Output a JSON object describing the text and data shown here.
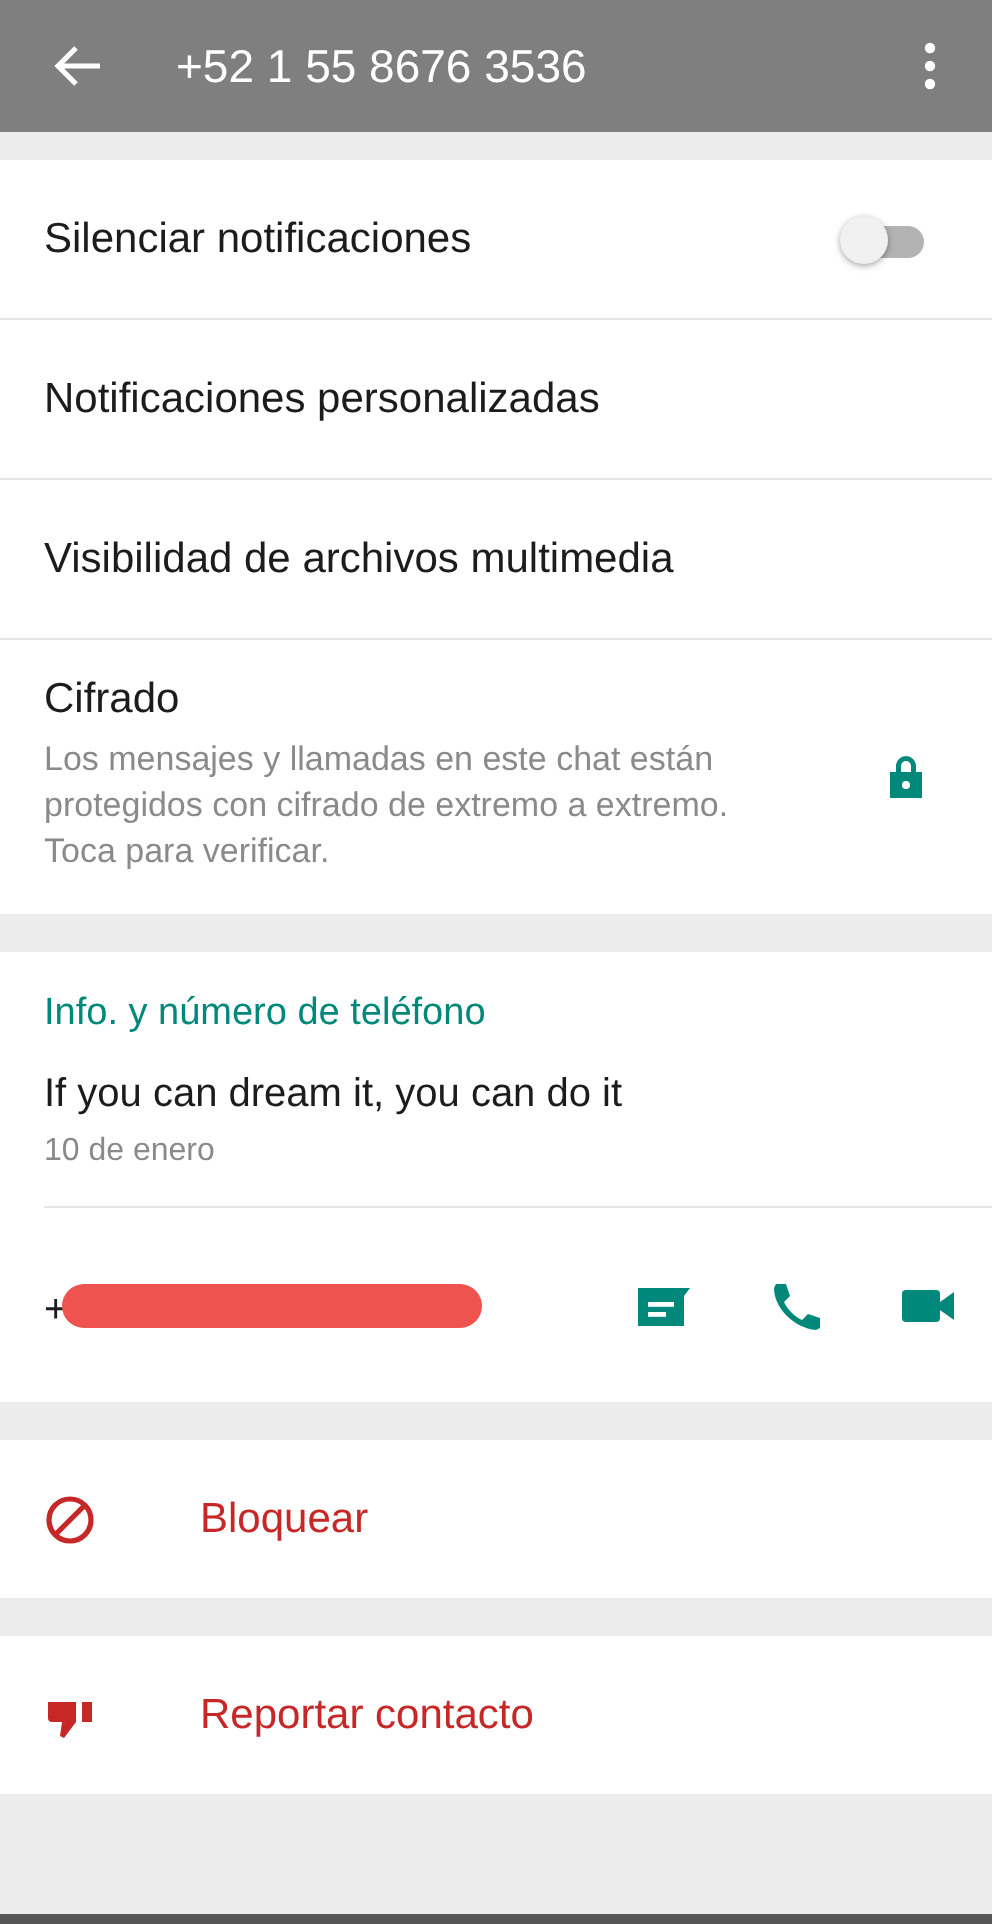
{
  "header": {
    "title": "+52 1 55 8676 3536"
  },
  "settings": [
    {
      "kind": "toggle",
      "label": "Silenciar notificaciones",
      "on": false
    },
    {
      "kind": "plain",
      "label": "Notificaciones personalizadas"
    },
    {
      "kind": "plain",
      "label": "Visibilidad de archivos multimedia"
    },
    {
      "kind": "lock",
      "label": "Cifrado",
      "description": "Los mensajes y llamadas en este chat están protegidos con cifrado de extremo a extremo. Toca para verificar."
    }
  ],
  "info": {
    "title": "Info. y número de teléfono",
    "status": "If you can dream it, you can do it",
    "date": "10 de enero",
    "phone": "+",
    "redacted": true
  },
  "actions": [
    {
      "kind": "block",
      "label": "Bloquear"
    },
    {
      "kind": "report",
      "label": "Reportar contacto"
    }
  ]
}
